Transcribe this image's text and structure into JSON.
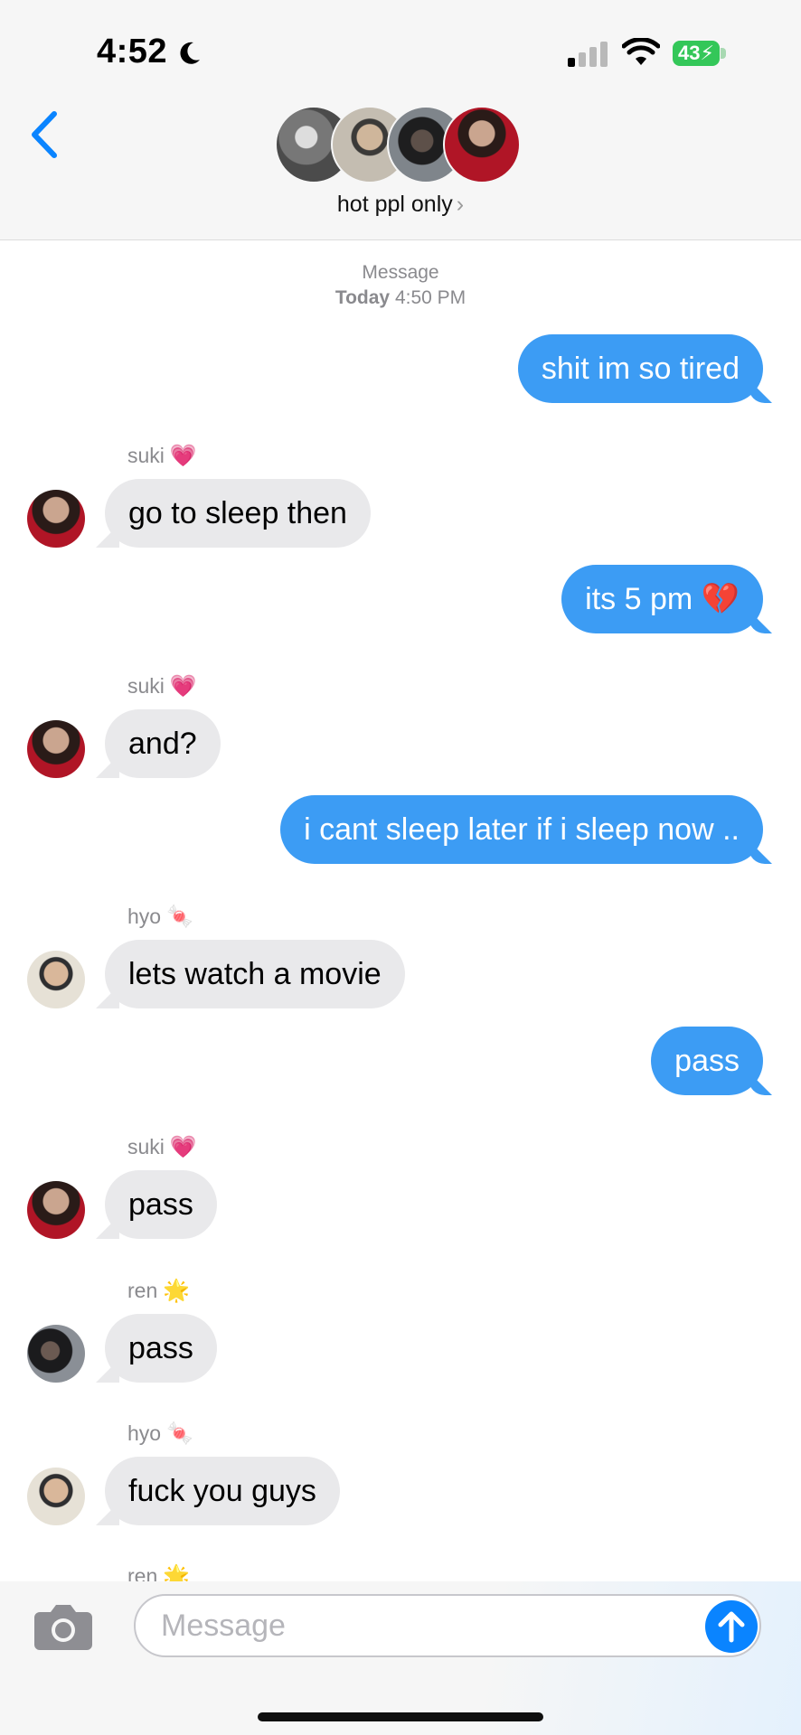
{
  "status_bar": {
    "time": "4:52",
    "battery": "43"
  },
  "header": {
    "group_name": "hot ppl only",
    "chevron": "›"
  },
  "conversation": {
    "meta_label": "Message",
    "date_label": "Today",
    "time_label": "4:50 PM",
    "messages": [
      {
        "direction": "out",
        "text": "shit im so tired"
      },
      {
        "direction": "in",
        "sender": "suki",
        "sender_emoji": "💗",
        "text": "go to sleep then"
      },
      {
        "direction": "out",
        "text": "its 5 pm 💔"
      },
      {
        "direction": "in",
        "sender": "suki",
        "sender_emoji": "💗",
        "text": "and?"
      },
      {
        "direction": "out",
        "text": "i cant sleep later if i sleep now .."
      },
      {
        "direction": "in",
        "sender": "hyo",
        "sender_emoji": "🍬",
        "text": "lets watch a movie"
      },
      {
        "direction": "out",
        "text": "pass"
      },
      {
        "direction": "in",
        "sender": "suki",
        "sender_emoji": "💗",
        "text": "pass"
      },
      {
        "direction": "in",
        "sender": "ren",
        "sender_emoji": "🌟",
        "text": "pass"
      },
      {
        "direction": "in",
        "sender": "hyo",
        "sender_emoji": "🍬",
        "text": "fuck you guys"
      },
      {
        "direction": "in",
        "sender": "ren",
        "sender_emoji": "🌟",
        "text": ""
      }
    ]
  },
  "compose": {
    "placeholder": "Message"
  },
  "colors": {
    "outgoing_bubble": "#3c9cf4",
    "incoming_bubble": "#e9e9eb",
    "accent": "#0a84ff"
  }
}
